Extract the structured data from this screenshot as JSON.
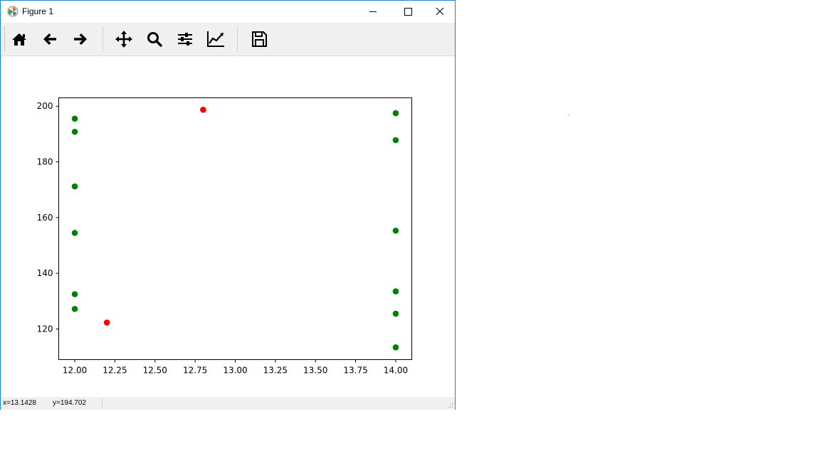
{
  "window": {
    "title": "Figure 1"
  },
  "toolbar": {
    "buttons": [
      {
        "icon": "home-icon"
      },
      {
        "icon": "back-arrow-icon"
      },
      {
        "icon": "forward-arrow-icon"
      },
      {
        "icon": "pan-icon"
      },
      {
        "icon": "zoom-icon"
      },
      {
        "icon": "subplots-icon"
      },
      {
        "icon": "edit-axis-icon"
      },
      {
        "icon": "save-icon"
      }
    ]
  },
  "status": {
    "x": "x=13.1428",
    "y": "y=194.702"
  },
  "chart_data": {
    "type": "scatter",
    "title": "",
    "xlabel": "",
    "ylabel": "",
    "xlim": [
      11.9,
      14.1
    ],
    "ylim": [
      109,
      203
    ],
    "xticks": [
      "12.00",
      "12.25",
      "12.50",
      "12.75",
      "13.00",
      "13.25",
      "13.50",
      "13.75",
      "14.00"
    ],
    "yticks": [
      "120",
      "140",
      "160",
      "180",
      "200"
    ],
    "grid": false,
    "series": [
      {
        "color": "#008000",
        "points": [
          [
            12.0,
            195.5
          ],
          [
            12.0,
            190.8
          ],
          [
            12.0,
            171.2
          ],
          [
            12.0,
            154.5
          ],
          [
            12.0,
            132.5
          ],
          [
            12.0,
            127.2
          ],
          [
            14.0,
            197.5
          ],
          [
            14.0,
            187.8
          ],
          [
            14.0,
            155.3
          ],
          [
            14.0,
            133.5
          ],
          [
            14.0,
            125.5
          ],
          [
            14.0,
            113.4
          ]
        ]
      },
      {
        "color": "#ff0000",
        "points": [
          [
            12.2,
            122.3
          ],
          [
            12.8,
            198.7
          ]
        ]
      }
    ]
  }
}
